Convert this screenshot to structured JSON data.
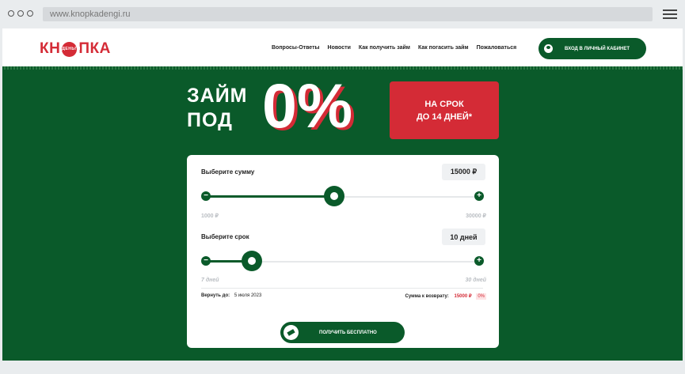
{
  "browser": {
    "url": "www.knopkadengi.ru"
  },
  "header": {
    "logo_left": "КН",
    "logo_coin": "ДЕНЬГИ",
    "logo_right": "ПКА",
    "nav": [
      "Вопросы-Ответы",
      "Новости",
      "Как получить займ",
      "Как погасить займ",
      "Пожаловаться"
    ],
    "login_label": "ВХОД В ЛИЧНЫЙ КАБИНЕТ"
  },
  "hero": {
    "title_line1": "ЗАЙМ",
    "title_line2": "ПОД",
    "rate": "0%",
    "promo_line1": "НА СРОК",
    "promo_line2": "ДО 14 ДНЕЙ*"
  },
  "calculator": {
    "amount": {
      "label": "Выберите сумму",
      "value": "15000 ₽",
      "min": "1000 ₽",
      "max": "30000 ₽",
      "minus": "−",
      "plus": "+",
      "position": 0.48
    },
    "term": {
      "label": "Выберите срок",
      "value": "10 дней",
      "min": "7 дней",
      "max": "30 дней",
      "minus": "−",
      "plus": "+",
      "position": 0.17
    },
    "return_label": "Вернуть до:",
    "return_date": "5 июля 2023",
    "sum_label": "Сумма к возврату:",
    "sum_value": "15000 ₽",
    "sum_percent": "0%",
    "cta_label": "ПОЛУЧИТЬ БЕСПЛАТНО"
  },
  "colors": {
    "brand_green": "#0a5a2a",
    "brand_red": "#d42b36"
  }
}
